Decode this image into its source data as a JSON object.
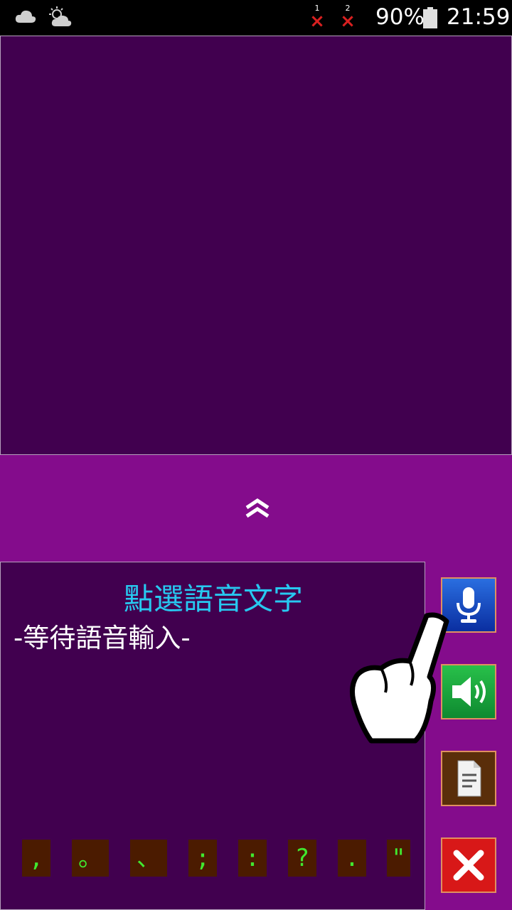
{
  "status_bar": {
    "icons": [
      "cloud-icon",
      "partly-cloudy-icon"
    ],
    "sim1": {
      "slot": "1",
      "state": "no-signal-icon"
    },
    "sim2": {
      "slot": "2",
      "state": "no-signal-icon"
    },
    "battery_percent": "90%",
    "time": "21:59"
  },
  "collapse": {
    "icon": "double-chevron-up-icon"
  },
  "voice_panel": {
    "title": "點選語音文字",
    "status": "-等待語音輸入-"
  },
  "punctuation_keys": [
    ",",
    "。",
    "、",
    ";",
    ":",
    "?",
    ".",
    "\""
  ],
  "side_buttons": {
    "mic": "microphone-icon",
    "speaker": "speaker-icon",
    "document": "document-icon",
    "close": "close-icon"
  },
  "colors": {
    "background": "#840c8c",
    "panel": "#41004f",
    "title": "#27c9f0",
    "punct_text": "#41e82f",
    "punct_bg": "#4b1b00"
  }
}
